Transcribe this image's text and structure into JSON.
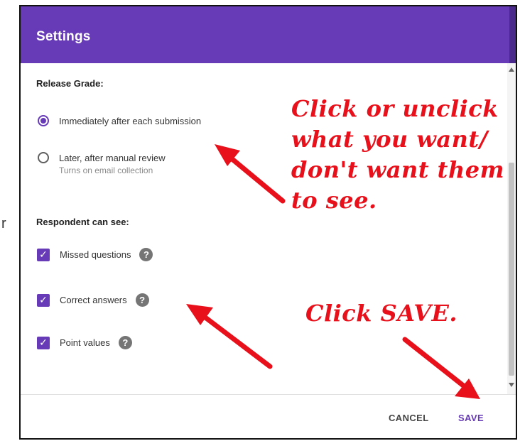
{
  "background": {
    "fragment": "r"
  },
  "dialog": {
    "title": "Settings",
    "colors": {
      "header": "#673ab7",
      "accent": "#673ab7",
      "annotation": "#e8101a"
    },
    "release_grade": {
      "label": "Release Grade:",
      "options": [
        {
          "label": "Immediately after each submission",
          "selected": true
        },
        {
          "label": "Later, after manual review",
          "sublabel": "Turns on email collection",
          "selected": false
        }
      ]
    },
    "respondent_can_see": {
      "label": "Respondent can see:",
      "items": [
        {
          "label": "Missed questions",
          "checked": true,
          "help_icon": "help-icon"
        },
        {
          "label": "Correct answers",
          "checked": true,
          "help_icon": "help-icon"
        },
        {
          "label": "Point values",
          "checked": true,
          "help_icon": "help-icon"
        }
      ]
    },
    "footer": {
      "cancel_label": "CANCEL",
      "save_label": "SAVE"
    }
  },
  "annotations": {
    "top_note": "Click or unclick\nwhat you want/\ndon't want them\nto see.",
    "save_note": "Click SAVE."
  },
  "icons": {
    "check": "✓",
    "help": "?"
  }
}
